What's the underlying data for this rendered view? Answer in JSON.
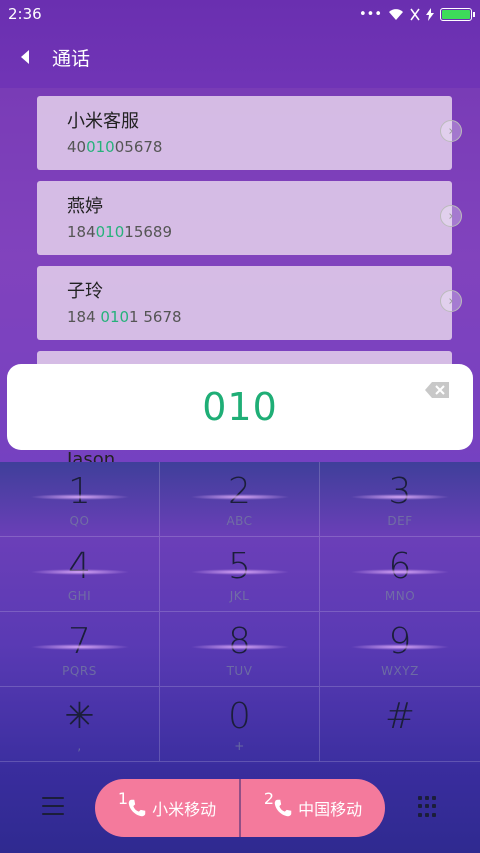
{
  "status": {
    "time": "2:36",
    "icons": [
      "more-dots-icon",
      "wifi-icon",
      "sim-off-icon",
      "charging-icon",
      "battery-icon"
    ],
    "battery_fill": 1.0,
    "battery_color": "#3ddb5a"
  },
  "header": {
    "title": "通话"
  },
  "contacts": [
    {
      "name": "小米客服",
      "num_pre": "40",
      "num_match": "010",
      "num_post": "05678"
    },
    {
      "name": "燕婷",
      "num_pre": "184",
      "num_match": "010",
      "num_post": "15689"
    },
    {
      "name": "子玲",
      "num_pre": "184 ",
      "num_match": "010",
      "num_post": "1 5678"
    }
  ],
  "partial_contact": {
    "name": "Jason"
  },
  "dial_input": {
    "value": "010",
    "color": "#1fae76"
  },
  "keypad": [
    {
      "digit": "1",
      "letters": "QO"
    },
    {
      "digit": "2",
      "letters": "ABC"
    },
    {
      "digit": "3",
      "letters": "DEF"
    },
    {
      "digit": "4",
      "letters": "GHI"
    },
    {
      "digit": "5",
      "letters": "JKL"
    },
    {
      "digit": "6",
      "letters": "MNO"
    },
    {
      "digit": "7",
      "letters": "PQRS"
    },
    {
      "digit": "8",
      "letters": "TUV"
    },
    {
      "digit": "9",
      "letters": "WXYZ"
    },
    {
      "digit": "✳",
      "letters": ","
    },
    {
      "digit": "0",
      "letters": "+"
    },
    {
      "digit": "#",
      "letters": ""
    }
  ],
  "call_buttons": [
    {
      "sim": "1",
      "label": "小米移动"
    },
    {
      "sim": "2",
      "label": "中国移动"
    }
  ],
  "colors": {
    "accent": "#1fae76",
    "call_button": "#f47a9c"
  }
}
